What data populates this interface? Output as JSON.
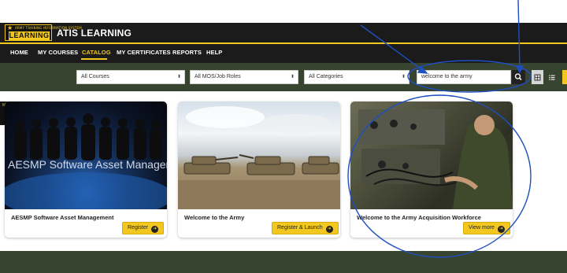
{
  "app": {
    "logo_small": "ARMY TRAINING INFORMATION SYSTEM",
    "logo_big": "LEARNING",
    "title": "ATIS LEARNING"
  },
  "nav": {
    "items": [
      {
        "label": "HOME",
        "active": false
      },
      {
        "label": "MY COURSES",
        "active": false
      },
      {
        "label": "CATALOG",
        "active": true
      },
      {
        "label": "MY CERTIFICATES",
        "active": false
      },
      {
        "label": "REPORTS",
        "active": false
      },
      {
        "label": "HELP",
        "active": false
      }
    ]
  },
  "filters": {
    "courses": "All Courses",
    "mos": "All MOS/Job Roles",
    "categories": "All Categories",
    "search_value": "welcome to the army",
    "search_icon": "search-icon",
    "grid_icon": "grid-view-icon",
    "list_icon": "list-view-icon"
  },
  "cards": [
    {
      "title": "AESMP Software Asset Management",
      "overlay": "AESMP Software Asset Management",
      "button": "Register",
      "side_label": "MP"
    },
    {
      "title": "Welcome to the Army",
      "button": "Register & Launch"
    },
    {
      "title": "Welcome to the Army Acquisition Workforce",
      "button": "View more"
    }
  ],
  "colors": {
    "accent": "#f2c81e",
    "header": "#1b1b1b",
    "bar": "#37442f",
    "annotation": "#1f4fc0"
  }
}
